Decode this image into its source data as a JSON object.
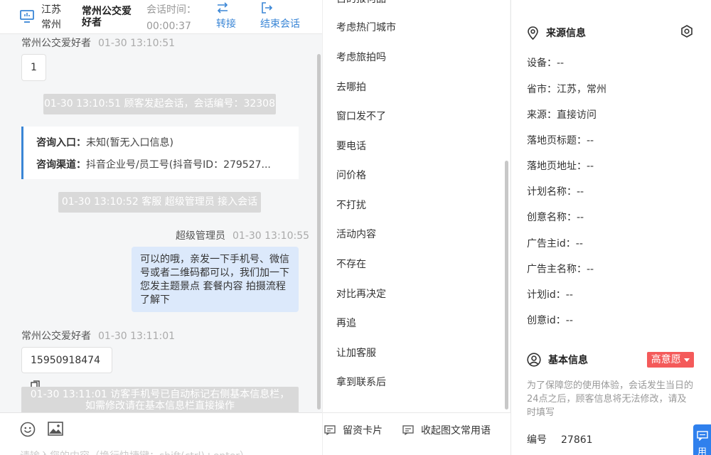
{
  "header": {
    "location": "江苏 常州",
    "customer_name": "常州公交爱好者",
    "session_time_label": "会话时间：",
    "session_time_value": "00:00:37",
    "transfer_label": "转接",
    "end_label": "结束会话"
  },
  "messages": {
    "m1_sender": "常州公交爱好者",
    "m1_time": "01-30 13:10:51",
    "m1_text": "1",
    "sys1": "01-30 13:10:51 顾客发起会话，会话编号：32308",
    "entry_label": "咨询入口：",
    "entry_value": "未知(暂无入口信息)",
    "channel_label": "咨询渠道：",
    "channel_value": "抖音企业号/员工号(抖音号ID：279527...",
    "sys2": "01-30 13:10:52 客服 超级管理员 接入会话",
    "agent_sender": "超级管理员",
    "agent_time": "01-30 13:10:55",
    "agent_text": "可以的哦，亲发一下手机号、微信号或者二维码都可以，我们加一下您发主题景点 套餐内容 拍摄流程了解下",
    "m2_sender": "常州公交爱好者",
    "m2_time": "01-30 13:11:01",
    "m2_text": "15950918474",
    "sys3_line1": "01-30 13:11:01 访客手机号已自动标记右侧基本信息栏，",
    "sys3_line2": "如需修改请在基本信息栏直接操作"
  },
  "input": {
    "placeholder": "请输入您的内容（换行快捷键：shift(ctrl)+enter）"
  },
  "phrases": {
    "items": [
      "考虑热门城市",
      "考虑旅拍吗",
      "去哪拍",
      "窗口发不了",
      "要电话",
      "问价格",
      "不打扰",
      "活动内容",
      "不存在",
      "对比再决定",
      "再追",
      "让加客服",
      "拿到联系后"
    ],
    "top_partial": "自的报何品",
    "card_btn": "留资卡片",
    "collect_btn": "收起图文常用语"
  },
  "info": {
    "source_title": "来源信息",
    "fields": [
      {
        "label": "设备：",
        "value": "--"
      },
      {
        "label": "省市：",
        "value": "江苏，常州"
      },
      {
        "label": "来源：",
        "value": "直接访问"
      },
      {
        "label": "落地页标题：",
        "value": "--"
      },
      {
        "label": "落地页地址：",
        "value": "--"
      },
      {
        "label": "计划名称：",
        "value": "--"
      },
      {
        "label": "创意名称：",
        "value": "--"
      },
      {
        "label": "广告主id：",
        "value": "--"
      },
      {
        "label": "广告主名称：",
        "value": "--"
      },
      {
        "label": "计划id：",
        "value": "--"
      },
      {
        "label": "创意id：",
        "value": "--"
      }
    ],
    "basic_title": "基本信息",
    "intent_badge": "高意愿",
    "note": "为了保障您的使用体验，会话发生当日的24点之后，顾客信息将无法修改，请及时填写",
    "id_label": "编号",
    "id_value": "27861",
    "float_btn": "用"
  },
  "colors": {
    "accent": "#3a86d6",
    "badge": "#f45a5a",
    "agent_bubble": "#dce9fb",
    "system_msg": "#d9d9d9"
  }
}
